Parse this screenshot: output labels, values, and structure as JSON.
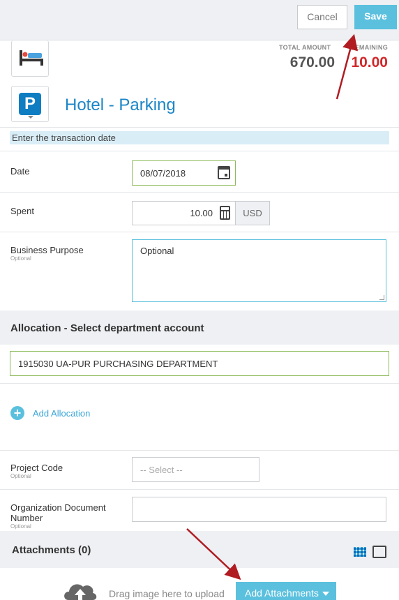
{
  "toolbar": {
    "cancel_label": "Cancel",
    "save_label": "Save"
  },
  "summary": {
    "total_label": "TOTAL AMOUNT",
    "total_value": "670.00",
    "remaining_label": "REMAINING",
    "remaining_value": "10.00"
  },
  "expense": {
    "title": "Hotel - Parking",
    "category_icon": "parking-icon",
    "parent_icon": "bed-icon"
  },
  "hint": "Enter the transaction date",
  "fields": {
    "date": {
      "label": "Date",
      "value": "08/07/2018"
    },
    "spent": {
      "label": "Spent",
      "value": "10.00",
      "currency": "USD"
    },
    "purpose": {
      "label": "Business Purpose",
      "sublabel": "Optional",
      "value": "Optional"
    },
    "project_code": {
      "label": "Project Code",
      "sublabel": "Optional",
      "value": "-- Select --"
    },
    "org_doc": {
      "label": "Organization Document Number",
      "sublabel": "Optional",
      "value": ""
    }
  },
  "allocation": {
    "title": "Allocation - Select department account",
    "value": "1915030 UA-PUR PURCHASING DEPARTMENT",
    "add_label": "Add Allocation"
  },
  "attachments": {
    "title": "Attachments  (0)",
    "drag_text": "Drag image here to upload",
    "add_label": "Add Attachments"
  },
  "colors": {
    "accent": "#5bc0de",
    "title_blue": "#1c86c7",
    "remaining_red": "#d0282a",
    "annotation_arrow": "#b01c22"
  }
}
